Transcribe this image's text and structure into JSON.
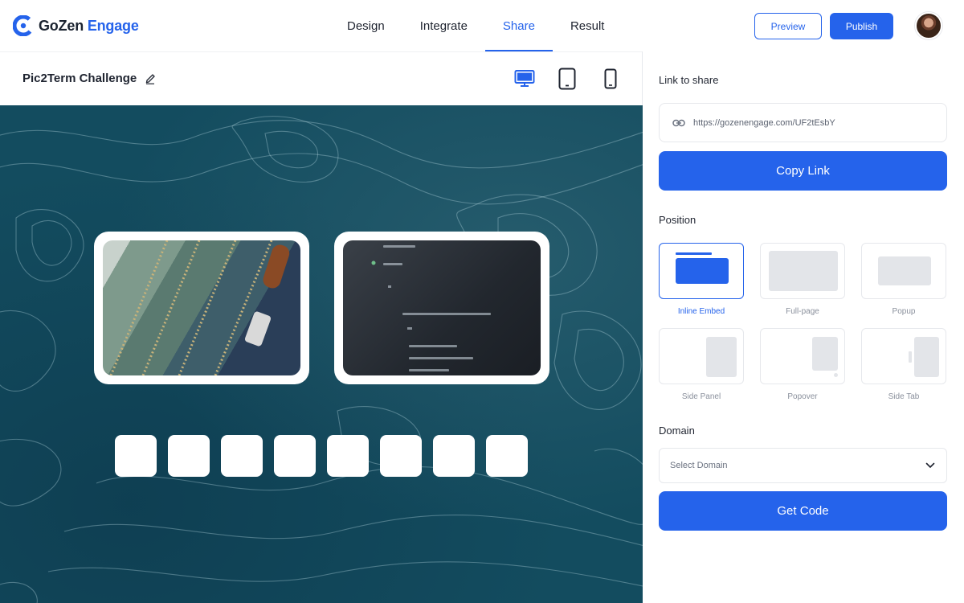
{
  "brand": {
    "part1": "GoZen",
    "part2": "Engage"
  },
  "nav": {
    "tabs": [
      "Design",
      "Integrate",
      "Share",
      "Result"
    ],
    "active": "Share"
  },
  "header": {
    "preview_label": "Preview",
    "publish_label": "Publish"
  },
  "project": {
    "title": "Pic2Term Challenge"
  },
  "share": {
    "link_label": "Link to share",
    "url": "https://gozenengage.com/UF2tEsbY",
    "copy_label": "Copy Link",
    "position_label": "Position",
    "positions": [
      "Inline Embed",
      "Full-page",
      "Popup",
      "Side Panel",
      "Popover",
      "Side Tab"
    ],
    "selected_position": "Inline Embed",
    "domain_label": "Domain",
    "domain_placeholder": "Select Domain",
    "get_code_label": "Get Code"
  },
  "colors": {
    "accent": "#2563eb",
    "canvas_bg": "#134c5f"
  },
  "icons": [
    "edit-icon",
    "desktop-icon",
    "tablet-icon",
    "mobile-icon",
    "link-icon",
    "chevron-down-icon"
  ]
}
